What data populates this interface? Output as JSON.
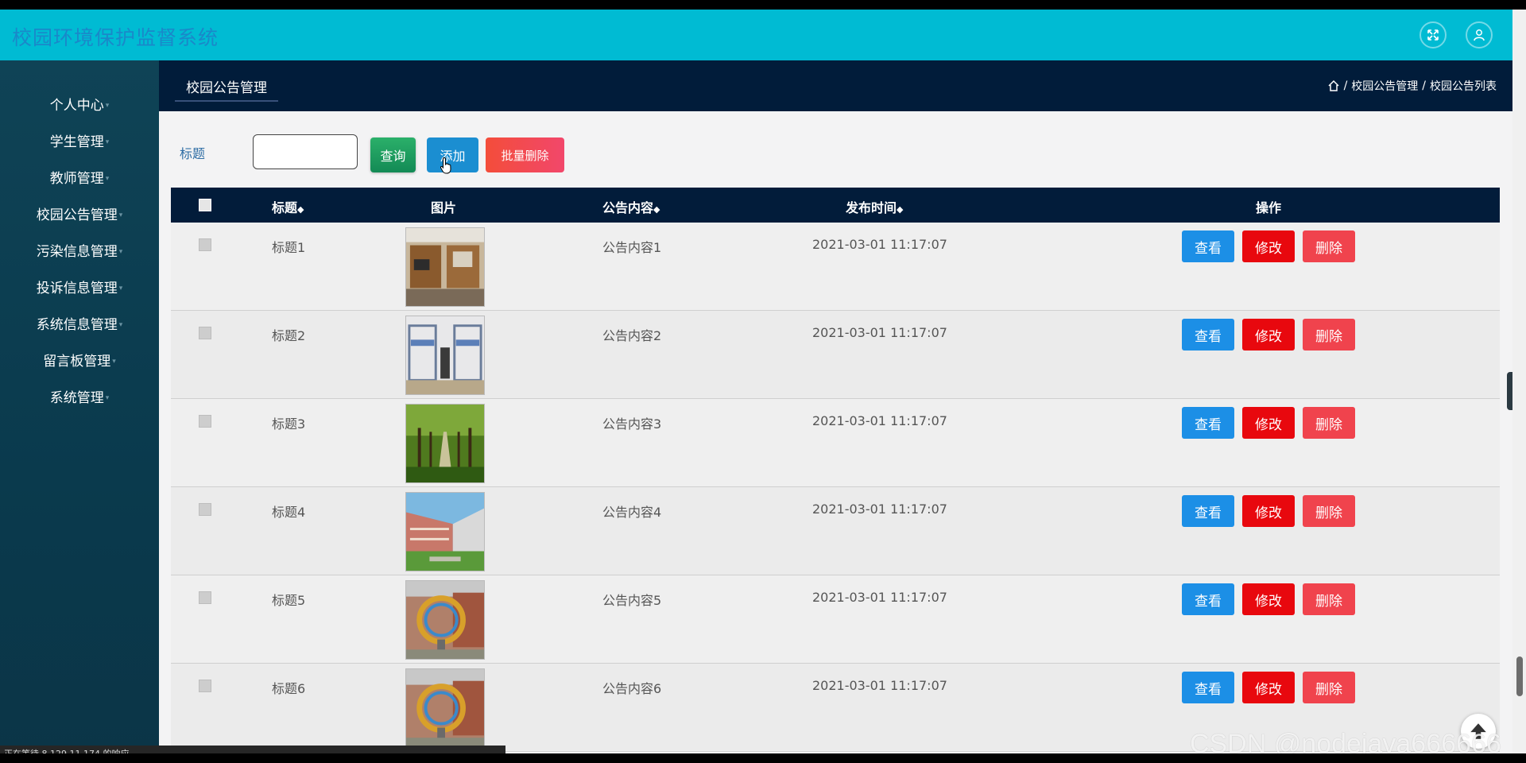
{
  "app": {
    "title": "校园环境保护监督系统"
  },
  "sidebar": {
    "items": [
      {
        "label": "个人中心"
      },
      {
        "label": "学生管理"
      },
      {
        "label": "教师管理"
      },
      {
        "label": "校园公告管理"
      },
      {
        "label": "污染信息管理"
      },
      {
        "label": "投诉信息管理"
      },
      {
        "label": "系统信息管理"
      },
      {
        "label": "留言板管理"
      },
      {
        "label": "系统管理"
      }
    ]
  },
  "content": {
    "tab": "校园公告管理",
    "breadcrumb": [
      "校园公告管理",
      "校园公告列表"
    ]
  },
  "search": {
    "label": "标题",
    "value": "",
    "query_label": "查询",
    "add_label": "添加",
    "batch_delete_label": "批量删除"
  },
  "table": {
    "headers": {
      "title": "标题",
      "image": "图片",
      "content": "公告内容",
      "time": "发布时间",
      "ops": "操作"
    },
    "sort_glyph": "◆",
    "rows": [
      {
        "title": "标题1",
        "content": "公告内容1",
        "time": "2021-03-01 11:17:07",
        "image": "dorm-desk"
      },
      {
        "title": "标题2",
        "content": "公告内容2",
        "time": "2021-03-01 11:17:07",
        "image": "dorm-beds"
      },
      {
        "title": "标题3",
        "content": "公告内容3",
        "time": "2021-03-01 11:17:07",
        "image": "tree-avenue"
      },
      {
        "title": "标题4",
        "content": "公告内容4",
        "time": "2021-03-01 11:17:07",
        "image": "campus-building"
      },
      {
        "title": "标题5",
        "content": "公告内容5",
        "time": "2021-03-01 11:17:07",
        "image": "ring-sculpture"
      },
      {
        "title": "标题6",
        "content": "公告内容6",
        "time": "2021-03-01 11:17:07",
        "image": "ring-sculpture"
      }
    ],
    "actions": {
      "view": "查看",
      "edit": "修改",
      "delete": "删除"
    }
  },
  "status": {
    "text": "正在等待 8.129.11.174 的响应..."
  },
  "watermark": {
    "text": "CSDN @nodejava666666"
  },
  "colors": {
    "topbar": "#00bbd3",
    "sidebar": "#0f4356",
    "content_header": "#011c3a",
    "view": "#1c8fe6",
    "edit": "#e8080e",
    "delete": "#f0434d"
  }
}
